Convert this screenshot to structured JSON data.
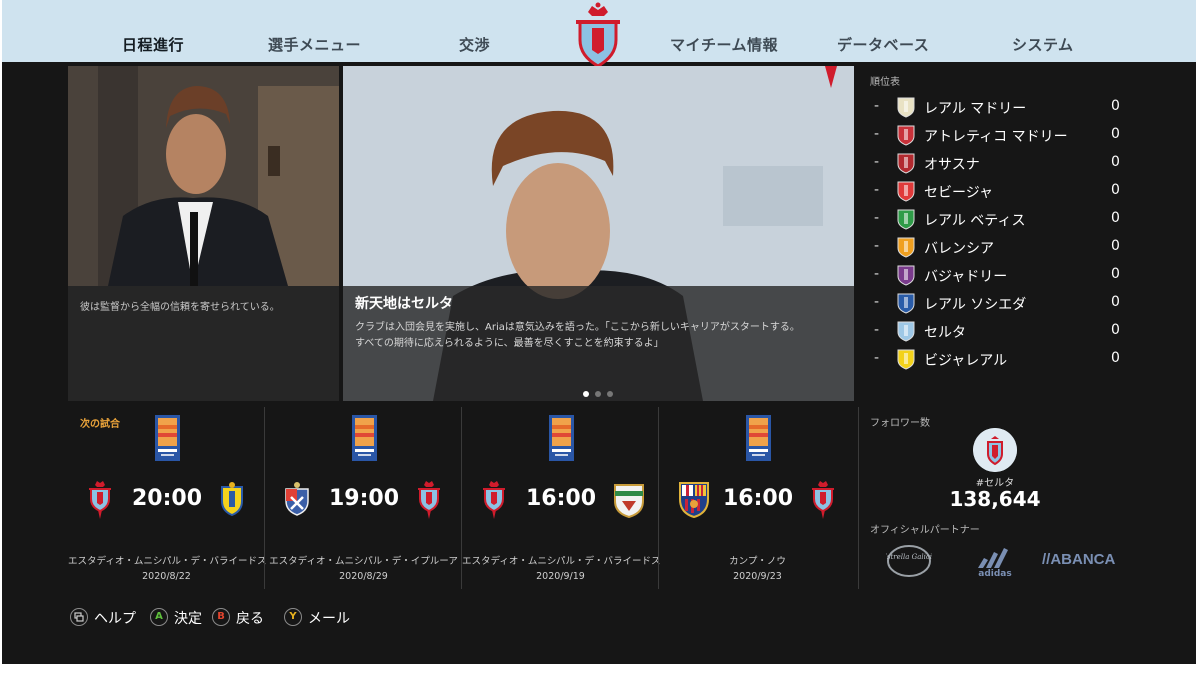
{
  "nav": {
    "tabs": [
      {
        "label": "日程進行",
        "active": true
      },
      {
        "label": "選手メニュー",
        "active": false
      },
      {
        "label": "交渉",
        "active": false
      },
      {
        "label": "マイチーム情報",
        "active": false
      },
      {
        "label": "データベース",
        "active": false
      },
      {
        "label": "システム",
        "active": false
      }
    ]
  },
  "news": {
    "left": {
      "caption": "彼は監督から全幅の信頼を寄せられている。"
    },
    "main": {
      "title": "新天地はセルタ",
      "body_line1": "クラブは入団会見を実施し、Ariaは意気込みを語った。「ここから新しいキャリアがスタートする。",
      "body_line2": "すべての期待に応えられるように、最善を尽くすことを約束するよ」"
    },
    "carousel": {
      "count": 3,
      "active": 0
    }
  },
  "standings": {
    "title": "順位表",
    "rows": [
      {
        "position": "-",
        "team": "レアル マドリー",
        "points": "0",
        "color": "#e9e2c4"
      },
      {
        "position": "-",
        "team": "アトレティコ マドリー",
        "points": "0",
        "color": "#c8323a"
      },
      {
        "position": "-",
        "team": "オサスナ",
        "points": "0",
        "color": "#b22a2f"
      },
      {
        "position": "-",
        "team": "セビージャ",
        "points": "0",
        "color": "#e03a3a"
      },
      {
        "position": "-",
        "team": "レアル ベティス",
        "points": "0",
        "color": "#2f9c48"
      },
      {
        "position": "-",
        "team": "バレンシア",
        "points": "0",
        "color": "#f0a020"
      },
      {
        "position": "-",
        "team": "バジャドリー",
        "points": "0",
        "color": "#7a3b8c"
      },
      {
        "position": "-",
        "team": "レアル ソシエダ",
        "points": "0",
        "color": "#2a5ca8"
      },
      {
        "position": "-",
        "team": "セルタ",
        "points": "0",
        "color": "#9ec8e6"
      },
      {
        "position": "-",
        "team": "ビジャレアル",
        "points": "0",
        "color": "#f3d21b"
      }
    ]
  },
  "fixtures": {
    "next_label": "次の試合",
    "competition_icon": "laliga-santander-icon",
    "matches": [
      {
        "home": "celta-crest",
        "away": "cadiz-crest",
        "time": "20:00",
        "venue": "エスタディオ・ムニシパル・デ・バライードス",
        "date": "2020/8/22"
      },
      {
        "home": "eibar-crest",
        "away": "celta-crest",
        "time": "19:00",
        "venue": "エスタディオ・ムニシパル・デ・イプルーア",
        "date": "2020/8/29"
      },
      {
        "home": "celta-crest",
        "away": "elche-crest",
        "time": "16:00",
        "venue": "エスタディオ・ムニシパル・デ・バライードス",
        "date": "2020/9/19"
      },
      {
        "home": "barcelona-crest",
        "away": "celta-crest",
        "time": "16:00",
        "venue": "カンプ・ノウ",
        "date": "2020/9/23"
      }
    ]
  },
  "social": {
    "followers_label": "フォロワー数",
    "hashtag": "#セルタ",
    "count": "138,644",
    "partners_label": "オフィシャルパートナー",
    "partners": [
      "Estrella Galicia",
      "adidas",
      "//ABANCA"
    ]
  },
  "controls": [
    {
      "button": "",
      "label": "ヘルプ",
      "color": "#bdbdbd",
      "icon": "view-icon"
    },
    {
      "button": "A",
      "label": "決定",
      "color": "#5fbf3c"
    },
    {
      "button": "B",
      "label": "戻る",
      "color": "#e0442e"
    },
    {
      "button": "Y",
      "label": "メール",
      "color": "#e8b21e"
    }
  ],
  "colors": {
    "celta_blue": "#8cc2e3",
    "celta_red": "#d01c2c",
    "nav_bg": "#cfe3ef",
    "panel_bg": "#161616",
    "accent_orange": "#e8a23a"
  }
}
